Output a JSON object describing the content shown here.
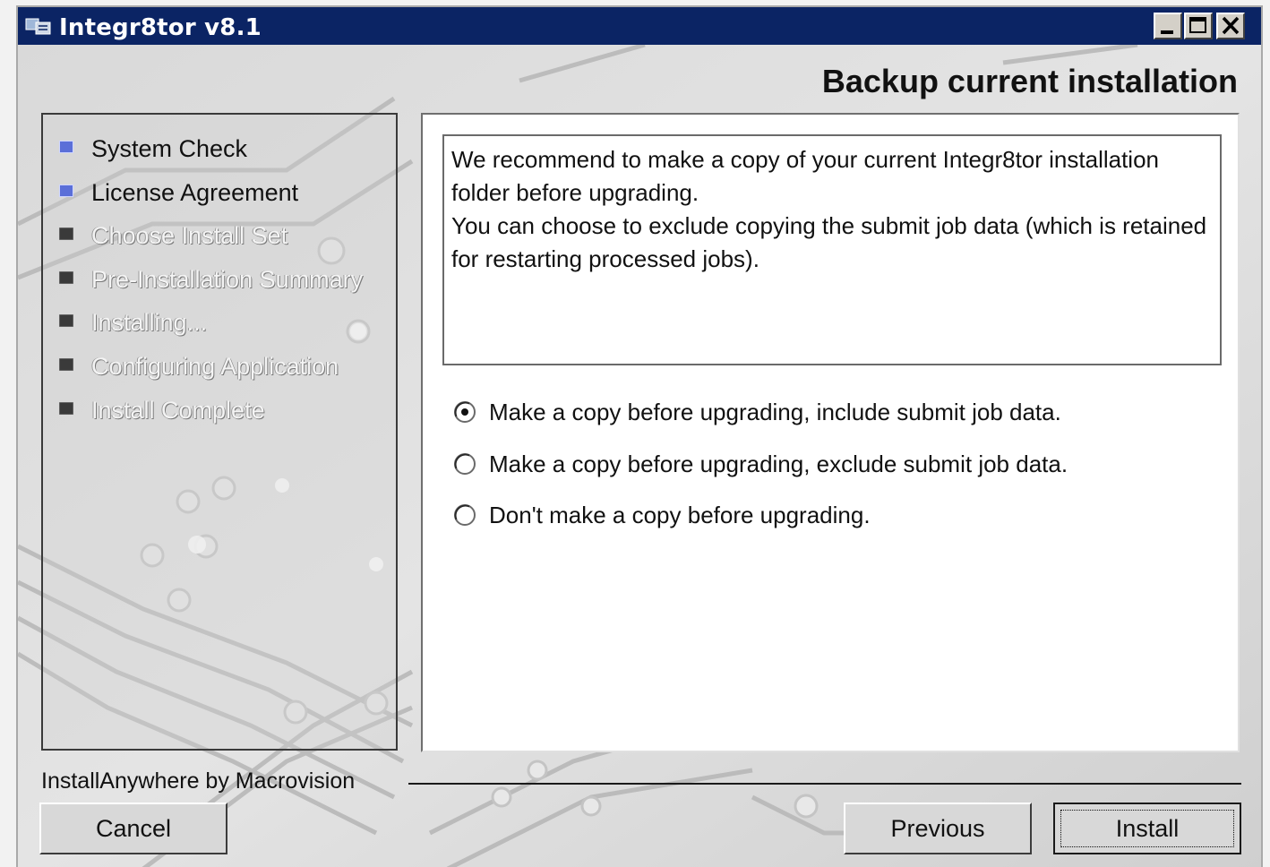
{
  "window": {
    "title": "Integr8tor  v8.1",
    "icon": "installer-app-icon",
    "controls": {
      "minimize": "minimize-icon",
      "maximize": "maximize-icon",
      "close": "close-icon"
    }
  },
  "page_title": "Backup current installation",
  "steps": [
    {
      "label": "System Check",
      "state": "done"
    },
    {
      "label": "License Agreement",
      "state": "done"
    },
    {
      "label": "Choose Install Set",
      "state": "pending"
    },
    {
      "label": "Pre-Installation Summary",
      "state": "pending"
    },
    {
      "label": "Installing...",
      "state": "pending"
    },
    {
      "label": "Configuring Application",
      "state": "pending"
    },
    {
      "label": "Install Complete",
      "state": "pending"
    }
  ],
  "description": {
    "line1": "We recommend to make a copy of your current Integr8tor installation folder before upgrading.",
    "line2": "You can choose to exclude copying the submit job data (which is retained for restarting processed jobs)."
  },
  "options": [
    {
      "label": "Make a copy before upgrading, include submit job data.",
      "selected": true
    },
    {
      "label": "Make a copy before upgrading, exclude submit job data.",
      "selected": false
    },
    {
      "label": "Don't make a copy before upgrading.",
      "selected": false
    }
  ],
  "footer": {
    "vendor": "InstallAnywhere by Macrovision",
    "cancel_label": "Cancel",
    "previous_label": "Previous",
    "install_label": "Install"
  },
  "colors": {
    "titlebar": "#0b2464",
    "step_done_bullet": "#5b6fd8",
    "step_pending_bullet": "#3a3a3a"
  }
}
